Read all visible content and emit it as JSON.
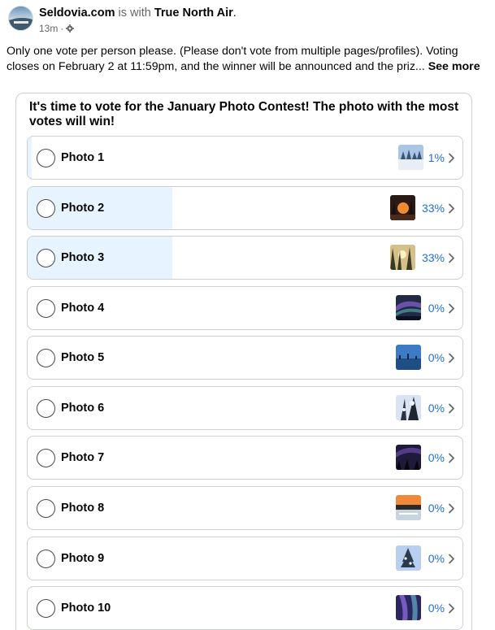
{
  "post": {
    "page_name": "Seldovia.com",
    "with_text": "is with",
    "partner": "True North Air",
    "period": ".",
    "time": "13m",
    "dot": "·",
    "text": "Only one vote per person please. (Please don't vote from multiple pages/profiles). Voting closes on February 2 at 11:59pm, and the winner will be announced and the priz...",
    "see_more": "See more"
  },
  "poll": {
    "question": "It's time to vote for the January Photo Contest! The photo with the most votes will win!",
    "options": [
      {
        "label": "Photo 1",
        "percent_text": "1%",
        "percent": 1,
        "thumb_icon": "snowy-trees-thumbnail"
      },
      {
        "label": "Photo 2",
        "percent_text": "33%",
        "percent": 33,
        "thumb_icon": "sunset-trees-thumbnail"
      },
      {
        "label": "Photo 3",
        "percent_text": "33%",
        "percent": 33,
        "thumb_icon": "forest-sunrise-thumbnail"
      },
      {
        "label": "Photo 4",
        "percent_text": "0%",
        "percent": 0,
        "thumb_icon": "aurora-thumbnail"
      },
      {
        "label": "Photo 5",
        "percent_text": "0%",
        "percent": 0,
        "thumb_icon": "blue-dusk-thumbnail"
      },
      {
        "label": "Photo 6",
        "percent_text": "0%",
        "percent": 0,
        "thumb_icon": "snowy-tree-closeup-thumbnail"
      },
      {
        "label": "Photo 7",
        "percent_text": "0%",
        "percent": 0,
        "thumb_icon": "night-sky-thumbnail"
      },
      {
        "label": "Photo 8",
        "percent_text": "0%",
        "percent": 0,
        "thumb_icon": "orange-sunset-water-thumbnail"
      },
      {
        "label": "Photo 9",
        "percent_text": "0%",
        "percent": 0,
        "thumb_icon": "frosted-tree-thumbnail"
      },
      {
        "label": "Photo 10",
        "percent_text": "0%",
        "percent": 0,
        "thumb_icon": "purple-aurora-thumbnail"
      }
    ]
  },
  "colors": {
    "fill": "#e7f3ff",
    "percent_text": "#216fdb",
    "border": "#ced0d4",
    "muted": "#65676b"
  }
}
